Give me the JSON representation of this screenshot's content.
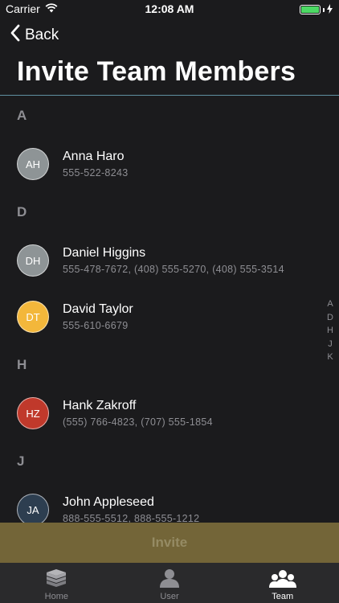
{
  "status": {
    "carrier": "Carrier",
    "time": "12:08 AM"
  },
  "nav": {
    "back_label": "Back",
    "title": "Invite Team Members"
  },
  "colors": {
    "accent_divider": "#5f8fa0",
    "invite_bar": "#736538"
  },
  "sections": [
    {
      "letter": "A",
      "contacts": [
        {
          "initials": "AH",
          "name": "Anna Haro",
          "phones": "555-522-8243",
          "avatar_color": "#8e9496"
        }
      ]
    },
    {
      "letter": "D",
      "contacts": [
        {
          "initials": "DH",
          "name": "Daniel Higgins",
          "phones": "555-478-7672, (408) 555-5270, (408) 555-3514",
          "avatar_color": "#8e9496"
        },
        {
          "initials": "DT",
          "name": "David Taylor",
          "phones": "555-610-6679",
          "avatar_color": "#f3b73b"
        }
      ]
    },
    {
      "letter": "H",
      "contacts": [
        {
          "initials": "HZ",
          "name": "Hank Zakroff",
          "phones": "(555) 766-4823, (707) 555-1854",
          "avatar_color": "#c0392b"
        }
      ]
    },
    {
      "letter": "J",
      "contacts": [
        {
          "initials": "JA",
          "name": "John Appleseed",
          "phones": "888-555-5512, 888-555-1212",
          "avatar_color": "#2d3e50"
        }
      ]
    }
  ],
  "index_letters": [
    "A",
    "D",
    "H",
    "J",
    "K"
  ],
  "invite_label": "Invite",
  "tabs": [
    {
      "label": "Home",
      "icon": "books-icon",
      "active": false
    },
    {
      "label": "User",
      "icon": "user-icon",
      "active": false
    },
    {
      "label": "Team",
      "icon": "team-icon",
      "active": true
    }
  ]
}
